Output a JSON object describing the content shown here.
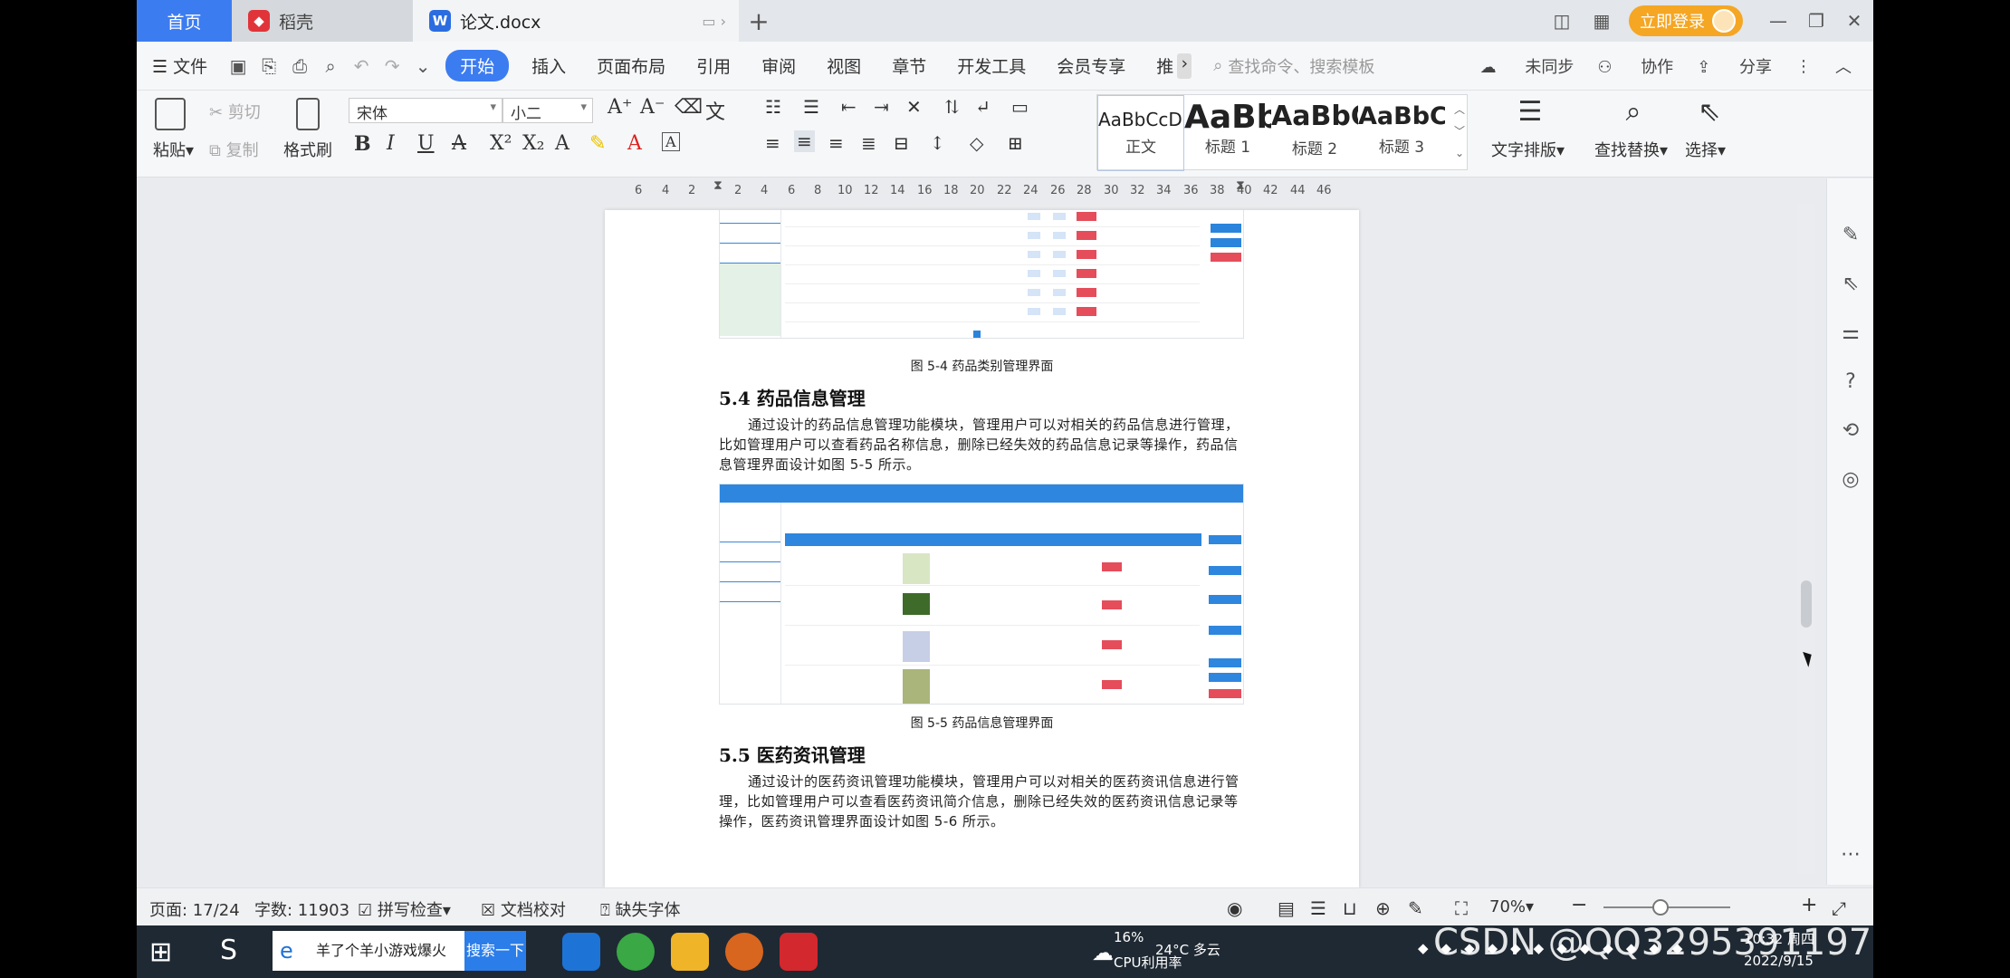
{
  "tabs": {
    "home": "首页",
    "daoke": "稻壳",
    "doc": "论文.docx"
  },
  "title_right": {
    "login": "立即登录"
  },
  "menu": {
    "file": "文件",
    "items": [
      "开始",
      "插入",
      "页面布局",
      "引用",
      "审阅",
      "视图",
      "章节",
      "开发工具",
      "会员专享",
      "推"
    ],
    "search_placeholder": "查找命令、搜索模板",
    "sync": "未同步",
    "collab": "协作",
    "share": "分享"
  },
  "ribbon": {
    "paste": "粘贴",
    "cut": "剪切",
    "copy": "复制",
    "format_painter": "格式刷",
    "font": "宋体",
    "size": "小二",
    "styles": [
      {
        "sample": "AaBbCcDd",
        "label": "正文"
      },
      {
        "sample": "AaBb",
        "label": "标题 1"
      },
      {
        "sample": "AaBbC",
        "label": "标题 2"
      },
      {
        "sample": "AaBbC",
        "label": "标题 3"
      }
    ],
    "text_layout": "文字排版",
    "find_replace": "查找替换",
    "select": "选择"
  },
  "ruler": [
    "6",
    "4",
    "2",
    "2",
    "4",
    "6",
    "8",
    "10",
    "12",
    "14",
    "16",
    "18",
    "20",
    "22",
    "24",
    "26",
    "28",
    "30",
    "32",
    "34",
    "36",
    "38",
    "40",
    "42",
    "44",
    "46"
  ],
  "doc": {
    "fig4_caption": "图 5-4 药品类别管理界面",
    "sec54": "5.4 药品信息管理",
    "para54": "通过设计的药品信息管理功能模块，管理用户可以对相关的药品信息进行管理，比如管理用户可以查看药品名称信息，删除已经失效的药品信息记录等操作，药品信息管理界面设计如图 5-5 所示。",
    "fig5_caption": "图 5-5 药品信息管理界面",
    "sec55": "5.5 医药资讯管理",
    "para55": "通过设计的医药资讯管理功能模块，管理用户可以对相关的医药资讯信息进行管理，比如管理用户可以查看医药资讯简介信息，删除已经失效的医药资讯信息记录等操作，医药资讯管理界面设计如图 5-6 所示。"
  },
  "status": {
    "page": "页面: 17/24",
    "words": "字数: 11903",
    "spell": "拼写检查",
    "proof": "文档校对",
    "missing_font": "缺失字体",
    "zoom": "70%"
  },
  "taskbar": {
    "search_text": "羊了个羊小游戏爆火",
    "search_btn": "搜索一下",
    "weather": "24°C 多云",
    "cpu": "16%",
    "cpu_label": "CPU利用率",
    "time": "10:32 周四",
    "date": "2022/9/15"
  },
  "watermark": "CSDN @QQ3295391197",
  "colors": {
    "accent": "#3c7cf1",
    "login": "#f5a623",
    "taskbar": "#1f2933"
  }
}
